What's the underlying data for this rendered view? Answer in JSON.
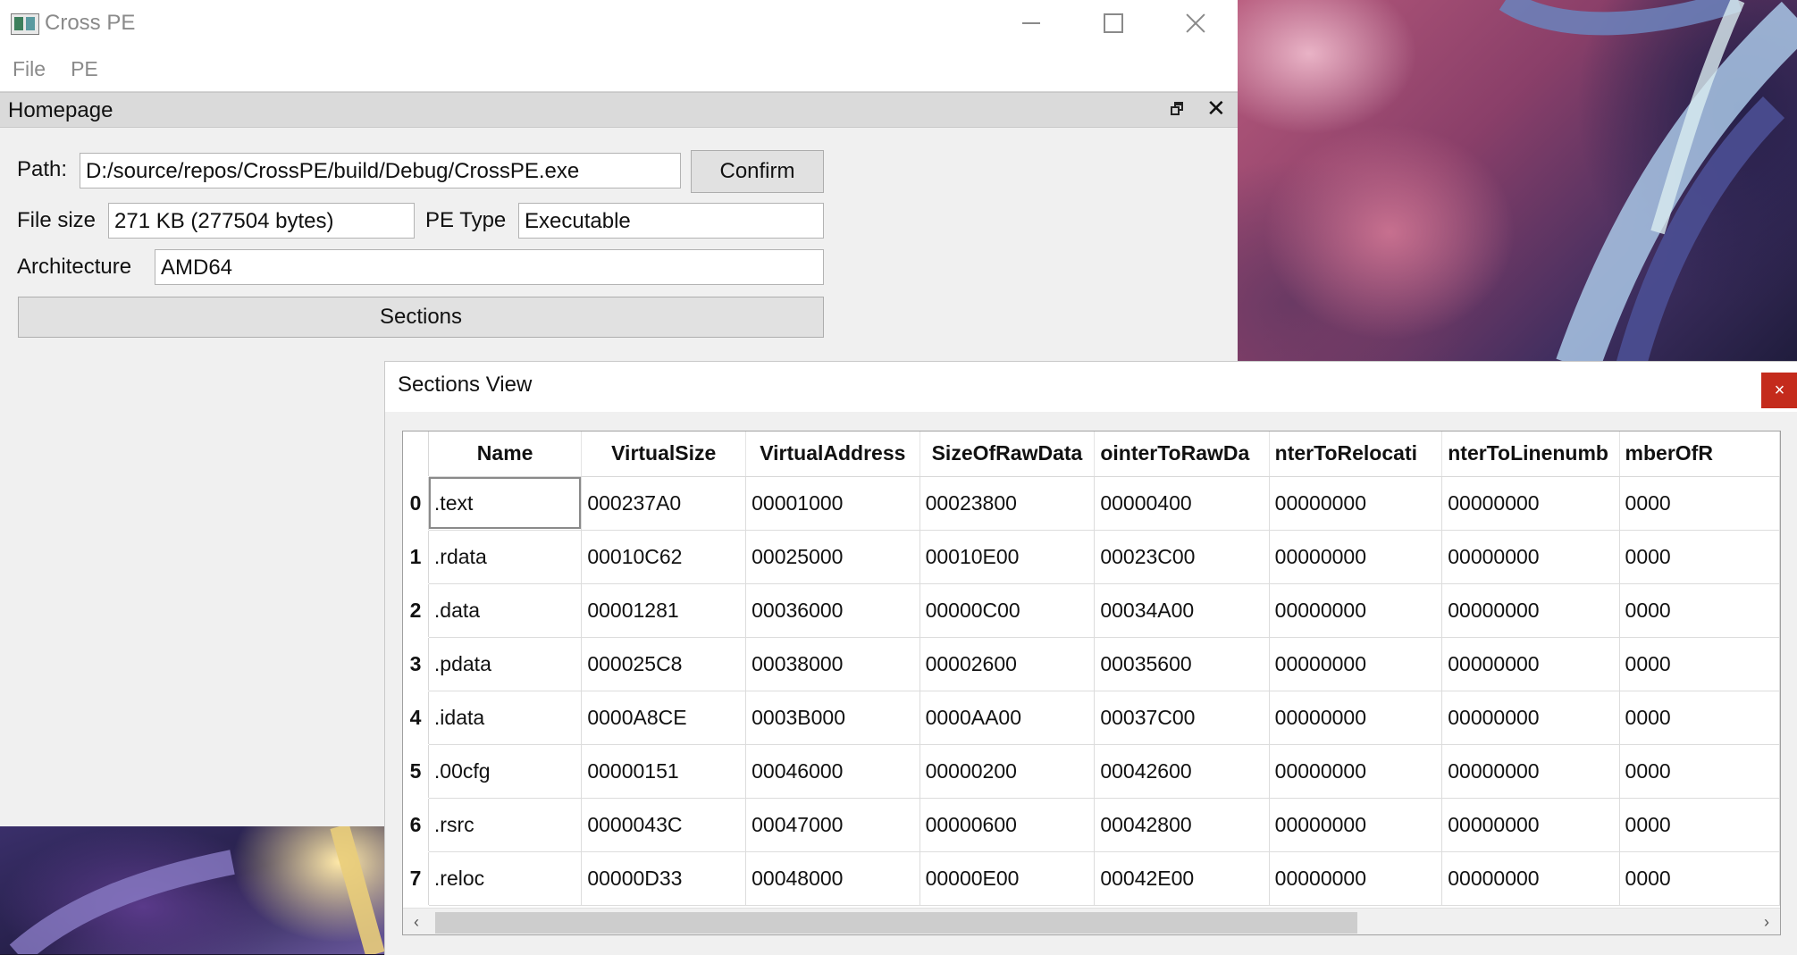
{
  "main_window": {
    "title": "Cross PE",
    "menu": [
      "File",
      "PE"
    ],
    "dock_title": "Homepage"
  },
  "form": {
    "path_label": "Path:",
    "path_value": "D:/source/repos/CrossPE/build/Debug/CrossPE.exe",
    "confirm_label": "Confirm",
    "file_size_label": "File size",
    "file_size_value": "271 KB (277504 bytes)",
    "pe_type_label": "PE Type",
    "pe_type_value": "Executable",
    "architecture_label": "Architecture",
    "architecture_value": "AMD64",
    "sections_button": "Sections"
  },
  "sections_view": {
    "title": "Sections View",
    "close_glyph": "×",
    "columns": [
      "Name",
      "VirtualSize",
      "VirtualAddress",
      "SizeOfRawData",
      "PointerToRawData",
      "PointerToRelocations",
      "PointerToLinenumbers",
      "NumberOfRelocations"
    ],
    "columns_visible": [
      "Name",
      "VirtualSize",
      "VirtualAddress",
      "SizeOfRawData",
      "ointerToRawDa",
      "nterToRelocati",
      "nterToLinenumb",
      "mberOfR"
    ],
    "rows": [
      {
        "index": "0",
        "cells": [
          ".text",
          "000237A0",
          "00001000",
          "00023800",
          "00000400",
          "00000000",
          "00000000",
          "0000"
        ]
      },
      {
        "index": "1",
        "cells": [
          ".rdata",
          "00010C62",
          "00025000",
          "00010E00",
          "00023C00",
          "00000000",
          "00000000",
          "0000"
        ]
      },
      {
        "index": "2",
        "cells": [
          ".data",
          "00001281",
          "00036000",
          "00000C00",
          "00034A00",
          "00000000",
          "00000000",
          "0000"
        ]
      },
      {
        "index": "3",
        "cells": [
          ".pdata",
          "000025C8",
          "00038000",
          "00002600",
          "00035600",
          "00000000",
          "00000000",
          "0000"
        ]
      },
      {
        "index": "4",
        "cells": [
          ".idata",
          "0000A8CE",
          "0003B000",
          "0000AA00",
          "00037C00",
          "00000000",
          "00000000",
          "0000"
        ]
      },
      {
        "index": "5",
        "cells": [
          ".00cfg",
          "00000151",
          "00046000",
          "00000200",
          "00042600",
          "00000000",
          "00000000",
          "0000"
        ]
      },
      {
        "index": "6",
        "cells": [
          ".rsrc",
          "0000043C",
          "00047000",
          "00000600",
          "00042800",
          "00000000",
          "00000000",
          "0000"
        ]
      },
      {
        "index": "7",
        "cells": [
          ".reloc",
          "00000D33",
          "00048000",
          "00000E00",
          "00042E00",
          "00000000",
          "00000000",
          "0000"
        ]
      }
    ]
  }
}
